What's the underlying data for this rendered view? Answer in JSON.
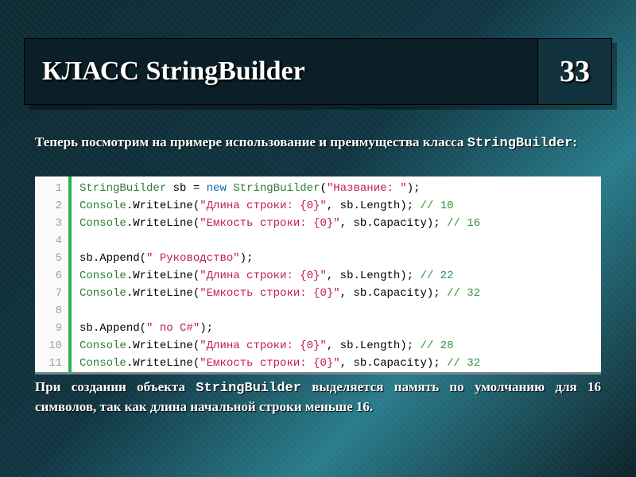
{
  "header": {
    "title": "КЛАСС StringBuilder",
    "page": "33"
  },
  "intro_parts": {
    "a": "Теперь посмотрим на примере использование и преимущества класса ",
    "b": "StringBuilder",
    "c": ":"
  },
  "outro_parts": {
    "a": "При создании объекта ",
    "b": "StringBuilder",
    "c": " выделяется память по умолчанию для 16 символов, так как длина начальной строки меньше 16."
  },
  "code": {
    "lines": [
      {
        "n": "1",
        "t": [
          [
            "ty",
            "StringBuilder"
          ],
          [
            "p",
            " sb "
          ],
          [
            "p",
            "= "
          ],
          [
            "kw",
            "new"
          ],
          [
            "p",
            " "
          ],
          [
            "ty",
            "StringBuilder"
          ],
          [
            "p",
            "("
          ],
          [
            "str",
            "\"Название: \""
          ],
          [
            "p",
            ");"
          ]
        ]
      },
      {
        "n": "2",
        "t": [
          [
            "ty",
            "Console"
          ],
          [
            "p",
            ".WriteLine("
          ],
          [
            "str",
            "\"Длина строки: {0}\""
          ],
          [
            "p",
            ", sb.Length); "
          ],
          [
            "cm",
            "// 10"
          ]
        ]
      },
      {
        "n": "3",
        "t": [
          [
            "ty",
            "Console"
          ],
          [
            "p",
            ".WriteLine("
          ],
          [
            "str",
            "\"Емкость строки: {0}\""
          ],
          [
            "p",
            ", sb.Capacity); "
          ],
          [
            "cm",
            "// 16"
          ]
        ]
      },
      {
        "n": "4",
        "t": [
          [
            "p",
            ""
          ]
        ]
      },
      {
        "n": "5",
        "t": [
          [
            "p",
            "sb"
          ],
          [
            "p",
            ".Append("
          ],
          [
            "str",
            "\" Руководство\""
          ],
          [
            "p",
            ");"
          ]
        ]
      },
      {
        "n": "6",
        "t": [
          [
            "ty",
            "Console"
          ],
          [
            "p",
            ".WriteLine("
          ],
          [
            "str",
            "\"Длина строки: {0}\""
          ],
          [
            "p",
            ", sb.Length); "
          ],
          [
            "cm",
            "// 22"
          ]
        ]
      },
      {
        "n": "7",
        "t": [
          [
            "ty",
            "Console"
          ],
          [
            "p",
            ".WriteLine("
          ],
          [
            "str",
            "\"Емкость строки: {0}\""
          ],
          [
            "p",
            ", sb.Capacity); "
          ],
          [
            "cm",
            "// 32"
          ]
        ]
      },
      {
        "n": "8",
        "t": [
          [
            "p",
            ""
          ]
        ]
      },
      {
        "n": "9",
        "t": [
          [
            "p",
            "sb"
          ],
          [
            "p",
            ".Append("
          ],
          [
            "str",
            "\" по C#\""
          ],
          [
            "p",
            ");"
          ]
        ]
      },
      {
        "n": "10",
        "t": [
          [
            "ty",
            "Console"
          ],
          [
            "p",
            ".WriteLine("
          ],
          [
            "str",
            "\"Длина строки: {0}\""
          ],
          [
            "p",
            ", sb.Length); "
          ],
          [
            "cm",
            "// 28"
          ]
        ]
      },
      {
        "n": "11",
        "t": [
          [
            "ty",
            "Console"
          ],
          [
            "p",
            ".WriteLine("
          ],
          [
            "str",
            "\"Емкость строки: {0}\""
          ],
          [
            "p",
            ", sb.Capacity); "
          ],
          [
            "cm",
            "// 32"
          ]
        ]
      }
    ]
  }
}
